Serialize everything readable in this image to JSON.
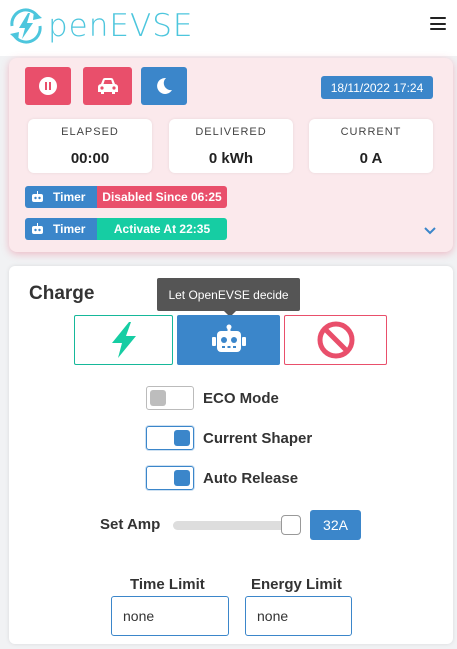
{
  "header": {
    "logo_text": "penEVSE",
    "menu_icon": "hamburger-icon"
  },
  "status": {
    "pause_icon": "pause-icon",
    "vehicle_icon": "car-icon",
    "sleep_icon": "moon-icon",
    "datetime": "18/11/2022 17:24",
    "stats": [
      {
        "label": "ELAPSED",
        "value": "00:00"
      },
      {
        "label": "DELIVERED",
        "value": "0 kWh"
      },
      {
        "label": "CURRENT",
        "value": "0 A"
      }
    ],
    "timers": [
      {
        "tag": "Timer",
        "status": "Disabled Since 06:25",
        "color": "#e94f6b"
      },
      {
        "tag": "Timer",
        "status": "Activate At 22:35",
        "color": "#16cda3"
      }
    ]
  },
  "charge": {
    "title": "Charge",
    "tooltip": "Let OpenEVSE decide",
    "modes": [
      "charge-bolt-icon",
      "robot-icon",
      "prohibited-icon"
    ],
    "toggles": [
      {
        "label": "ECO Mode",
        "on": false
      },
      {
        "label": "Current Shaper",
        "on": true
      },
      {
        "label": "Auto Release",
        "on": true
      }
    ],
    "set_amp_label": "Set Amp",
    "amp_value": "32A",
    "time_limit_label": "Time Limit",
    "time_limit_value": "none",
    "energy_limit_label": "Energy Limit",
    "energy_limit_value": "none"
  },
  "colors": {
    "accent_blue": "#3b86ca",
    "danger_red": "#e94f6b",
    "success_green": "#16cda3",
    "logo_cyan": "#4dc6dd"
  }
}
